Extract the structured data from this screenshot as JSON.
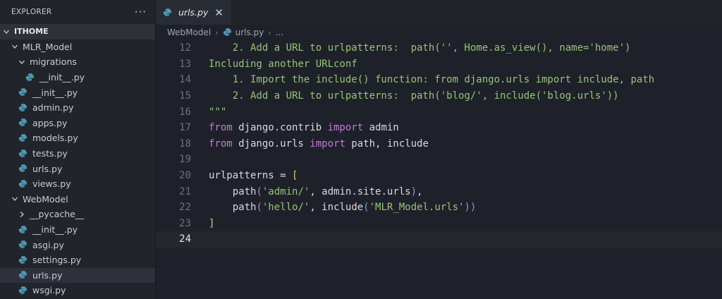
{
  "sidebar": {
    "title": "EXPLORER",
    "more": "···",
    "tree": [
      {
        "label": "ITHOME",
        "type": "project",
        "indent": 0,
        "chevron": "down"
      },
      {
        "label": "MLR_Model",
        "type": "folder",
        "indent": 1,
        "chevron": "down"
      },
      {
        "label": "migrations",
        "type": "folder",
        "indent": 2,
        "chevron": "down"
      },
      {
        "label": "__init__.py",
        "type": "file",
        "indent": 3
      },
      {
        "label": "__init__.py",
        "type": "file",
        "indent": 2
      },
      {
        "label": "admin.py",
        "type": "file",
        "indent": 2
      },
      {
        "label": "apps.py",
        "type": "file",
        "indent": 2
      },
      {
        "label": "models.py",
        "type": "file",
        "indent": 2
      },
      {
        "label": "tests.py",
        "type": "file",
        "indent": 2
      },
      {
        "label": "urls.py",
        "type": "file",
        "indent": 2
      },
      {
        "label": "views.py",
        "type": "file",
        "indent": 2
      },
      {
        "label": "WebModel",
        "type": "folder",
        "indent": 1,
        "chevron": "down"
      },
      {
        "label": "__pycache__",
        "type": "folder",
        "indent": 2,
        "chevron": "right"
      },
      {
        "label": "__init__.py",
        "type": "file",
        "indent": 2
      },
      {
        "label": "asgi.py",
        "type": "file",
        "indent": 2
      },
      {
        "label": "settings.py",
        "type": "file",
        "indent": 2
      },
      {
        "label": "urls.py",
        "type": "file",
        "indent": 2,
        "active": true
      },
      {
        "label": "wsgi.py",
        "type": "file",
        "indent": 2
      }
    ]
  },
  "tab": {
    "label": "urls.py",
    "close": "✕"
  },
  "breadcrumb": {
    "folder": "WebModel",
    "file": "urls.py",
    "more": "..."
  },
  "code": {
    "current_line": 24,
    "lines": [
      {
        "n": 12,
        "tokens": [
          {
            "t": "    2. Add a URL to urlpatterns:  path('', Home.as_view(), name='home')",
            "c": "doc"
          }
        ]
      },
      {
        "n": 13,
        "tokens": [
          {
            "t": "Including another URLconf",
            "c": "doc"
          }
        ]
      },
      {
        "n": 14,
        "tokens": [
          {
            "t": "    1. Import the include() function: from django.urls import include, path",
            "c": "doc"
          }
        ]
      },
      {
        "n": 15,
        "tokens": [
          {
            "t": "    2. Add a URL to urlpatterns:  path('blog/', include('blog.urls'))",
            "c": "doc"
          }
        ]
      },
      {
        "n": 16,
        "tokens": [
          {
            "t": "\"\"\"",
            "c": "doc"
          }
        ]
      },
      {
        "n": 17,
        "tokens": [
          {
            "t": "from",
            "c": "kw"
          },
          {
            "t": " django.contrib ",
            "c": "plain"
          },
          {
            "t": "import",
            "c": "kw"
          },
          {
            "t": " admin",
            "c": "plain"
          }
        ]
      },
      {
        "n": 18,
        "tokens": [
          {
            "t": "from",
            "c": "kw"
          },
          {
            "t": " django.urls ",
            "c": "plain"
          },
          {
            "t": "import",
            "c": "kw"
          },
          {
            "t": " path, include",
            "c": "plain"
          }
        ]
      },
      {
        "n": 19,
        "tokens": []
      },
      {
        "n": 20,
        "tokens": [
          {
            "t": "urlpatterns = ",
            "c": "plain"
          },
          {
            "t": "[",
            "c": "br"
          }
        ]
      },
      {
        "n": 21,
        "tokens": [
          {
            "t": "    path",
            "c": "plain"
          },
          {
            "t": "(",
            "c": "br2"
          },
          {
            "t": "'admin/'",
            "c": "str"
          },
          {
            "t": ", admin.site.urls",
            "c": "plain"
          },
          {
            "t": ")",
            "c": "br2"
          },
          {
            "t": ",",
            "c": "plain"
          }
        ]
      },
      {
        "n": 22,
        "tokens": [
          {
            "t": "    path",
            "c": "plain"
          },
          {
            "t": "(",
            "c": "br2"
          },
          {
            "t": "'hello/'",
            "c": "str"
          },
          {
            "t": ", include",
            "c": "plain"
          },
          {
            "t": "(",
            "c": "br3"
          },
          {
            "t": "'MLR_Model.urls'",
            "c": "str"
          },
          {
            "t": ")",
            "c": "br3"
          },
          {
            "t": ")",
            "c": "br2"
          }
        ]
      },
      {
        "n": 23,
        "tokens": [
          {
            "t": "]",
            "c": "br"
          }
        ]
      },
      {
        "n": 24,
        "tokens": []
      }
    ]
  },
  "colors": {
    "python_icon": "#519aba",
    "accent": "#c678dd"
  }
}
